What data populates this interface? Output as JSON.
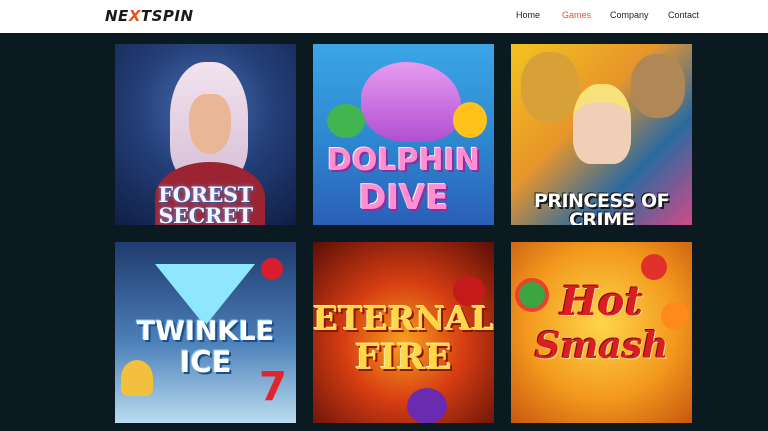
{
  "brand": {
    "prefix": "NE",
    "highlight": "X",
    "suffix": "TSPIN"
  },
  "nav": {
    "items": [
      {
        "label": "Home",
        "active": false
      },
      {
        "label": "Games",
        "active": true
      },
      {
        "label": "Company",
        "active": false
      },
      {
        "label": "Contact",
        "active": false
      }
    ]
  },
  "games": [
    {
      "title_lines": [
        "FOREST SECRET"
      ]
    },
    {
      "title_lines": [
        "DOLPHIN",
        "DIVE"
      ]
    },
    {
      "title_lines": [
        "PRINCESS OF CRIME"
      ]
    },
    {
      "title_lines": [
        "TWINKLE",
        "ICE"
      ]
    },
    {
      "title_lines": [
        "ETERNAL",
        "FIRE"
      ]
    },
    {
      "title_lines": [
        "Hot",
        "Smash"
      ]
    }
  ],
  "colors": {
    "accent": "#e0562a",
    "background": "#0b1a20",
    "header": "#ffffff"
  }
}
